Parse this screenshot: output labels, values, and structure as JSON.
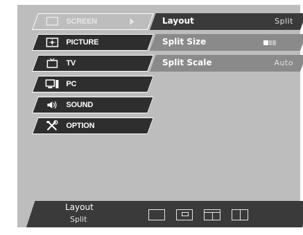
{
  "menu": {
    "items": [
      {
        "label": "SCREEN",
        "icon": "screen-icon",
        "selected": true
      },
      {
        "label": "PICTURE",
        "icon": "picture-icon",
        "selected": false
      },
      {
        "label": "TV",
        "icon": "tv-icon",
        "selected": false
      },
      {
        "label": "PC",
        "icon": "pc-icon",
        "selected": false
      },
      {
        "label": "SOUND",
        "icon": "sound-icon",
        "selected": false
      },
      {
        "label": "OPTION",
        "icon": "option-icon",
        "selected": false
      }
    ]
  },
  "options": [
    {
      "label": "Layout",
      "value": "Split",
      "active": true
    },
    {
      "label": "Split Size",
      "value": "",
      "size_level": 0.33,
      "active": false
    },
    {
      "label": "Split Scale",
      "value": "Auto",
      "active": false
    }
  ],
  "info": {
    "title": "Layout",
    "value": "Split",
    "layout_icons": [
      "layout-single-icon",
      "layout-pip-icon",
      "layout-split-horizontal-icon",
      "layout-split-vertical-icon"
    ]
  },
  "colors": {
    "panel": "#bdbdbd",
    "menu_dark": "#2e2e2e",
    "option_active": "#3a3a3a",
    "option_inactive": "#8a8a8a"
  }
}
